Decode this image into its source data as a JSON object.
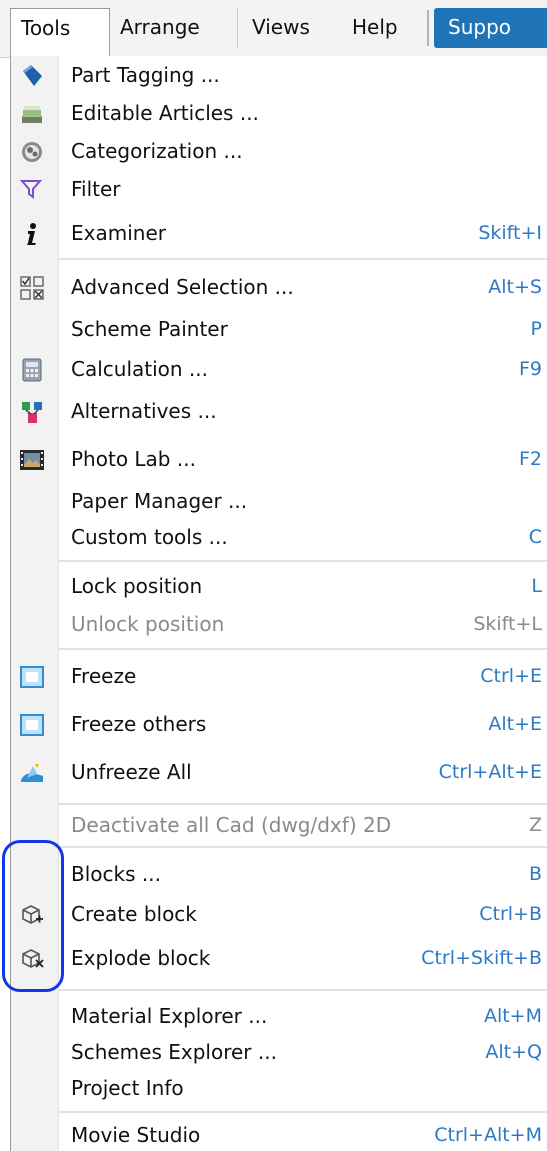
{
  "menubar": {
    "tabs": [
      "Tools",
      "Arrange",
      "Views",
      "Help"
    ],
    "support_label": "Suppo"
  },
  "menu": {
    "items": [
      {
        "label": "Part Tagging ...",
        "shortcut": "",
        "icon": "tag-icon"
      },
      {
        "label": "Editable Articles ...",
        "shortcut": "",
        "icon": "articles-icon"
      },
      {
        "label": "Categorization ...",
        "shortcut": "",
        "icon": "categorization-icon"
      },
      {
        "label": "Filter",
        "shortcut": "",
        "icon": "filter-icon"
      },
      {
        "label": "Examiner",
        "shortcut": "Skift+I",
        "icon": "info-icon"
      },
      {
        "label": "Advanced Selection ...",
        "shortcut": "Alt+S",
        "icon": "selection-grid-icon"
      },
      {
        "label": "Scheme Painter",
        "shortcut": "P",
        "icon": ""
      },
      {
        "label": "Calculation ...",
        "shortcut": "F9",
        "icon": "calculator-icon"
      },
      {
        "label": "Alternatives ...",
        "shortcut": "",
        "icon": "alternatives-icon"
      },
      {
        "label": "Photo Lab ...",
        "shortcut": "F2",
        "icon": "film-icon"
      },
      {
        "label": "Paper Manager ...",
        "shortcut": "",
        "icon": ""
      },
      {
        "label": "Custom tools ...",
        "shortcut": "C",
        "icon": ""
      },
      {
        "label": "Lock position",
        "shortcut": "L",
        "icon": ""
      },
      {
        "label": "Unlock position",
        "shortcut": "Skift+L",
        "icon": "",
        "disabled": true
      },
      {
        "label": "Freeze",
        "shortcut": "Ctrl+E",
        "icon": "freeze-icon"
      },
      {
        "label": "Freeze others",
        "shortcut": "Alt+E",
        "icon": "freeze-others-icon"
      },
      {
        "label": "Unfreeze All",
        "shortcut": "Ctrl+Alt+E",
        "icon": "unfreeze-icon"
      },
      {
        "label": "Deactivate all Cad (dwg/dxf) 2D",
        "shortcut": "Z",
        "icon": "",
        "disabled": true
      },
      {
        "label": "Blocks ...",
        "shortcut": "B",
        "icon": ""
      },
      {
        "label": "Create block",
        "shortcut": "Ctrl+B",
        "icon": "create-block-icon"
      },
      {
        "label": "Explode block",
        "shortcut": "Ctrl+Skift+B",
        "icon": "explode-block-icon"
      },
      {
        "label": "Material Explorer ...",
        "shortcut": "Alt+M",
        "icon": ""
      },
      {
        "label": "Schemes Explorer ...",
        "shortcut": "Alt+Q",
        "icon": ""
      },
      {
        "label": "Project Info",
        "shortcut": "",
        "icon": ""
      },
      {
        "label": "Movie Studio",
        "shortcut": "Ctrl+Alt+M",
        "icon": ""
      }
    ]
  },
  "colors": {
    "shortcut": "#2e79c4",
    "support_bg": "#1f73b7",
    "highlight_ring": "#1336e6"
  }
}
